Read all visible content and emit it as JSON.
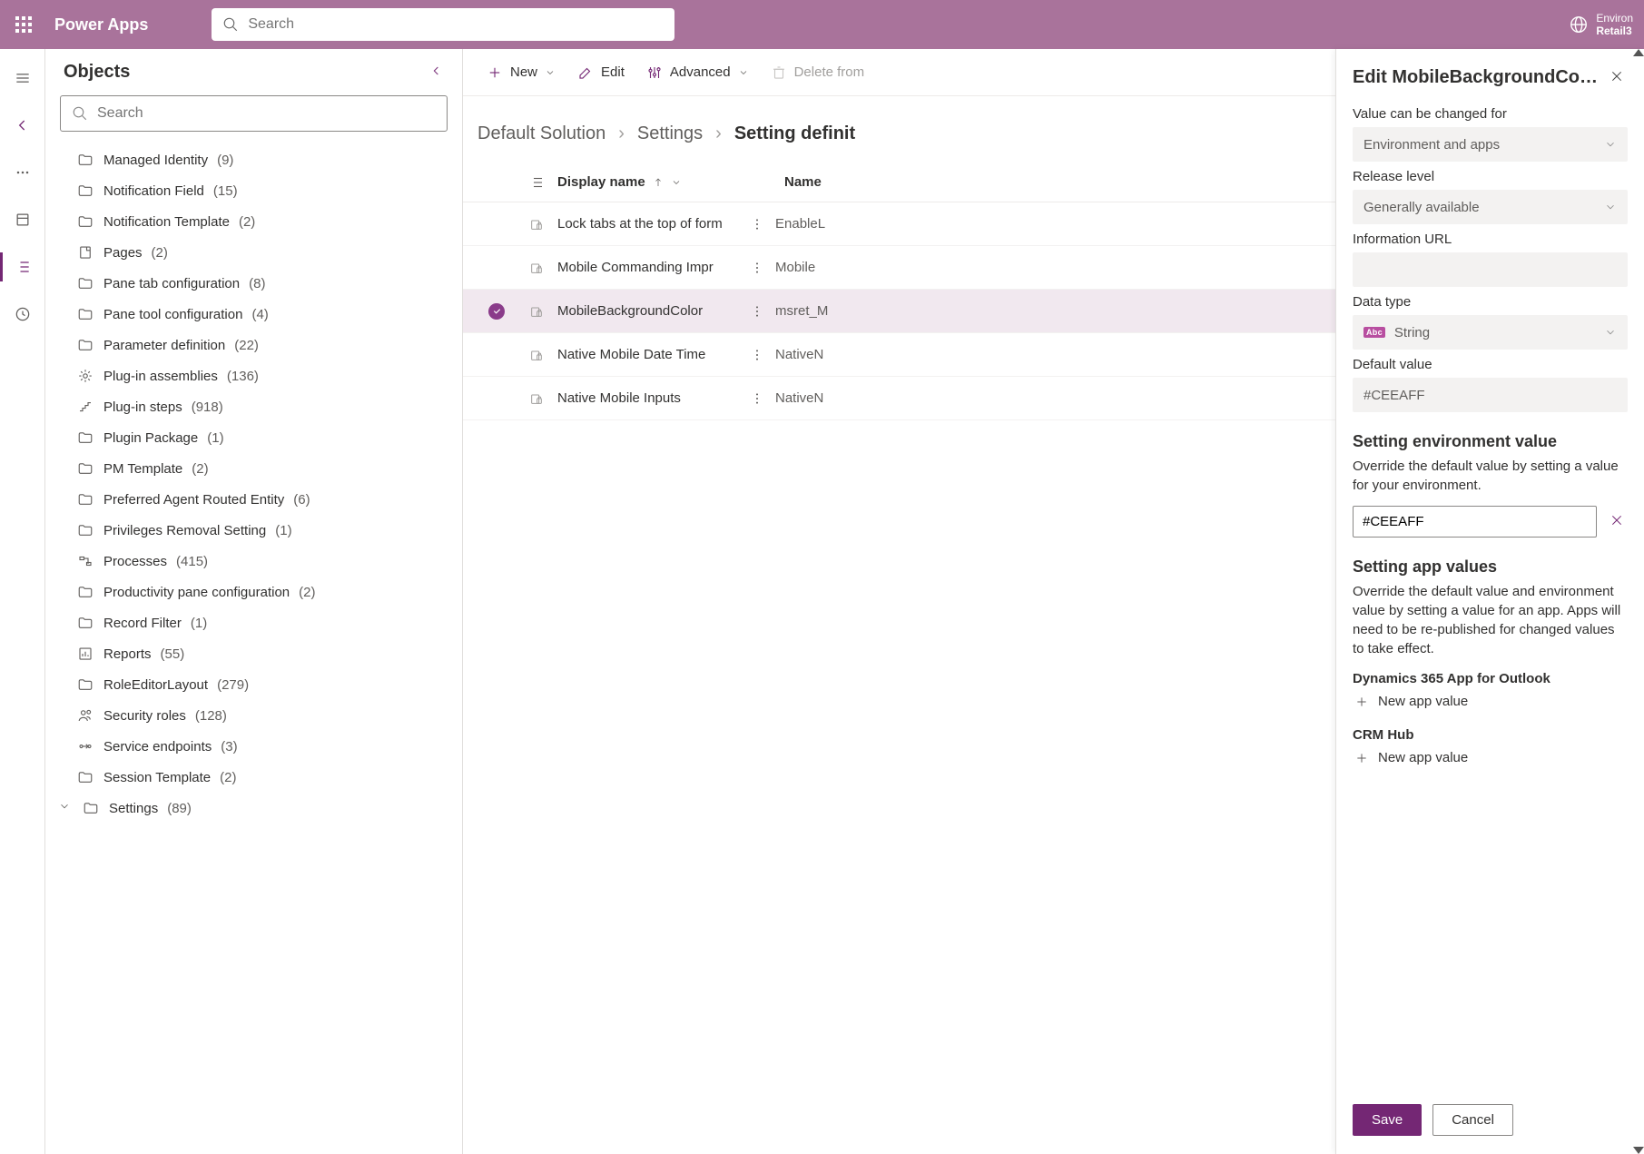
{
  "header": {
    "brand": "Power Apps",
    "search_placeholder": "Search",
    "env_label": "Environ",
    "env_value": "Retail3"
  },
  "objects": {
    "title": "Objects",
    "search_placeholder": "Search",
    "items": [
      {
        "icon": "folder",
        "label": "Managed Identity",
        "count": "(9)"
      },
      {
        "icon": "folder",
        "label": "Notification Field",
        "count": "(15)"
      },
      {
        "icon": "folder",
        "label": "Notification Template",
        "count": "(2)"
      },
      {
        "icon": "page",
        "label": "Pages",
        "count": "(2)"
      },
      {
        "icon": "folder",
        "label": "Pane tab configuration",
        "count": "(8)"
      },
      {
        "icon": "folder",
        "label": "Pane tool configuration",
        "count": "(4)"
      },
      {
        "icon": "folder",
        "label": "Parameter definition",
        "count": "(22)"
      },
      {
        "icon": "plugin",
        "label": "Plug-in assemblies",
        "count": "(136)"
      },
      {
        "icon": "steps",
        "label": "Plug-in steps",
        "count": "(918)"
      },
      {
        "icon": "folder",
        "label": "Plugin Package",
        "count": "(1)"
      },
      {
        "icon": "folder",
        "label": "PM Template",
        "count": "(2)"
      },
      {
        "icon": "folder",
        "label": "Preferred Agent Routed Entity",
        "count": "(6)"
      },
      {
        "icon": "folder",
        "label": "Privileges Removal Setting",
        "count": "(1)"
      },
      {
        "icon": "process",
        "label": "Processes",
        "count": "(415)"
      },
      {
        "icon": "folder",
        "label": "Productivity pane configuration",
        "count": "(2)"
      },
      {
        "icon": "folder",
        "label": "Record Filter",
        "count": "(1)"
      },
      {
        "icon": "report",
        "label": "Reports",
        "count": "(55)"
      },
      {
        "icon": "folder",
        "label": "RoleEditorLayout",
        "count": "(279)"
      },
      {
        "icon": "roles",
        "label": "Security roles",
        "count": "(128)"
      },
      {
        "icon": "endpoint",
        "label": "Service endpoints",
        "count": "(3)"
      },
      {
        "icon": "folder",
        "label": "Session Template",
        "count": "(2)"
      },
      {
        "icon": "folder",
        "label": "Settings",
        "count": "(89)",
        "caret": true
      }
    ]
  },
  "cmdbar": {
    "new": "New",
    "edit": "Edit",
    "advanced": "Advanced",
    "delete": "Delete from"
  },
  "crumbs": {
    "root": "Default Solution",
    "mid": "Settings",
    "current": "Setting definit"
  },
  "grid": {
    "col_display": "Display name",
    "col_name": "Name",
    "rows": [
      {
        "display": "Lock tabs at the top of form",
        "name": "EnableL",
        "selected": false
      },
      {
        "display": "Mobile Commanding Impr",
        "name": "Mobile",
        "selected": false
      },
      {
        "display": "MobileBackgroundColor",
        "name": "msret_M",
        "selected": true
      },
      {
        "display": "Native Mobile Date Time",
        "name": "NativeN",
        "selected": false
      },
      {
        "display": "Native Mobile Inputs",
        "name": "NativeN",
        "selected": false
      }
    ]
  },
  "panel": {
    "title": "Edit MobileBackgroundCo…",
    "value_changed_label": "Value can be changed for",
    "value_changed_value": "Environment and apps",
    "release_label": "Release level",
    "release_value": "Generally available",
    "info_url_label": "Information URL",
    "info_url_value": "",
    "datatype_label": "Data type",
    "datatype_value": "String",
    "default_label": "Default value",
    "default_value": "#CEEAFF",
    "env_section_title": "Setting environment value",
    "env_section_desc": "Override the default value by setting a value for your environment.",
    "env_input_value": "#CEEAFF",
    "app_section_title": "Setting app values",
    "app_section_desc": "Override the default value and environment value by setting a value for an app. Apps will need to be re-published for changed values to take effect.",
    "app1": "Dynamics 365 App for Outlook",
    "app2": "CRM Hub",
    "new_app_value": "New app value",
    "save": "Save",
    "cancel": "Cancel"
  }
}
